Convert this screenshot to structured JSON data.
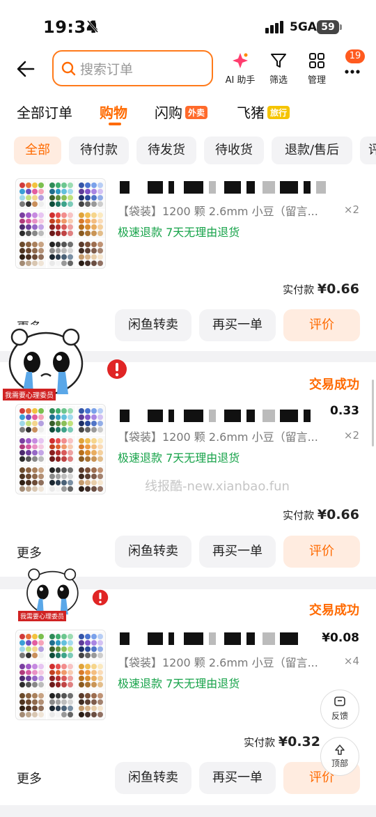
{
  "status_bar": {
    "time": "19:34",
    "network": "5GA",
    "battery": "59"
  },
  "header": {
    "search_placeholder": "搜索订单",
    "tools": [
      {
        "label": "AI 助手",
        "icon": "ai-sparkle-icon"
      },
      {
        "label": "筛选",
        "icon": "funnel-icon"
      },
      {
        "label": "管理",
        "icon": "grid-icon"
      }
    ],
    "more_badge": "19"
  },
  "category_tabs": [
    {
      "label": "全部订单",
      "active": false
    },
    {
      "label": "购物",
      "active": true
    },
    {
      "label": "闪购",
      "tag": "外卖"
    },
    {
      "label": "飞猪",
      "tag": "旅行"
    }
  ],
  "filters": [
    "全部",
    "待付款",
    "待发货",
    "待收货",
    "退款/售后",
    "评"
  ],
  "orders": [
    {
      "status": "",
      "price_right": "",
      "spec": "【袋装】1200 颗 2.6mm 小豆（留言...",
      "qty": "×2",
      "service": "极速退款  7天无理由退货",
      "paid_label": "实付款",
      "paid_amount": "¥0.66",
      "more": "更多",
      "buttons": [
        "闲鱼转卖",
        "再买一单",
        "评价"
      ]
    },
    {
      "status": "交易成功",
      "price_right": "0.33",
      "spec": "【袋装】1200 颗 2.6mm 小豆（留言...",
      "qty": "×2",
      "service": "极速退款  7天无理由退货",
      "paid_label": "实付款",
      "paid_amount": "¥0.66",
      "more": "更多",
      "buttons": [
        "闲鱼转卖",
        "再买一单",
        "评价"
      ]
    },
    {
      "status": "交易成功",
      "price_right": "¥0.08",
      "spec": "【袋装】1200 颗 2.6mm 小豆（留言...",
      "qty": "×4",
      "service": "极速退款  7天无理由退货",
      "paid_label": "实付款",
      "paid_amount": "¥0.32",
      "more": "更多",
      "buttons": [
        "闲鱼转卖",
        "再买一单",
        "评价"
      ]
    }
  ],
  "sticker_label": "我需要心理委员",
  "watermark": "线报酷-new.xianbao.fun",
  "floating": {
    "feedback": "反馈",
    "top": "顶部"
  },
  "colors": {
    "accent": "#ff6a00",
    "service_green": "#17a34a",
    "badge": "#ff5a1f"
  }
}
